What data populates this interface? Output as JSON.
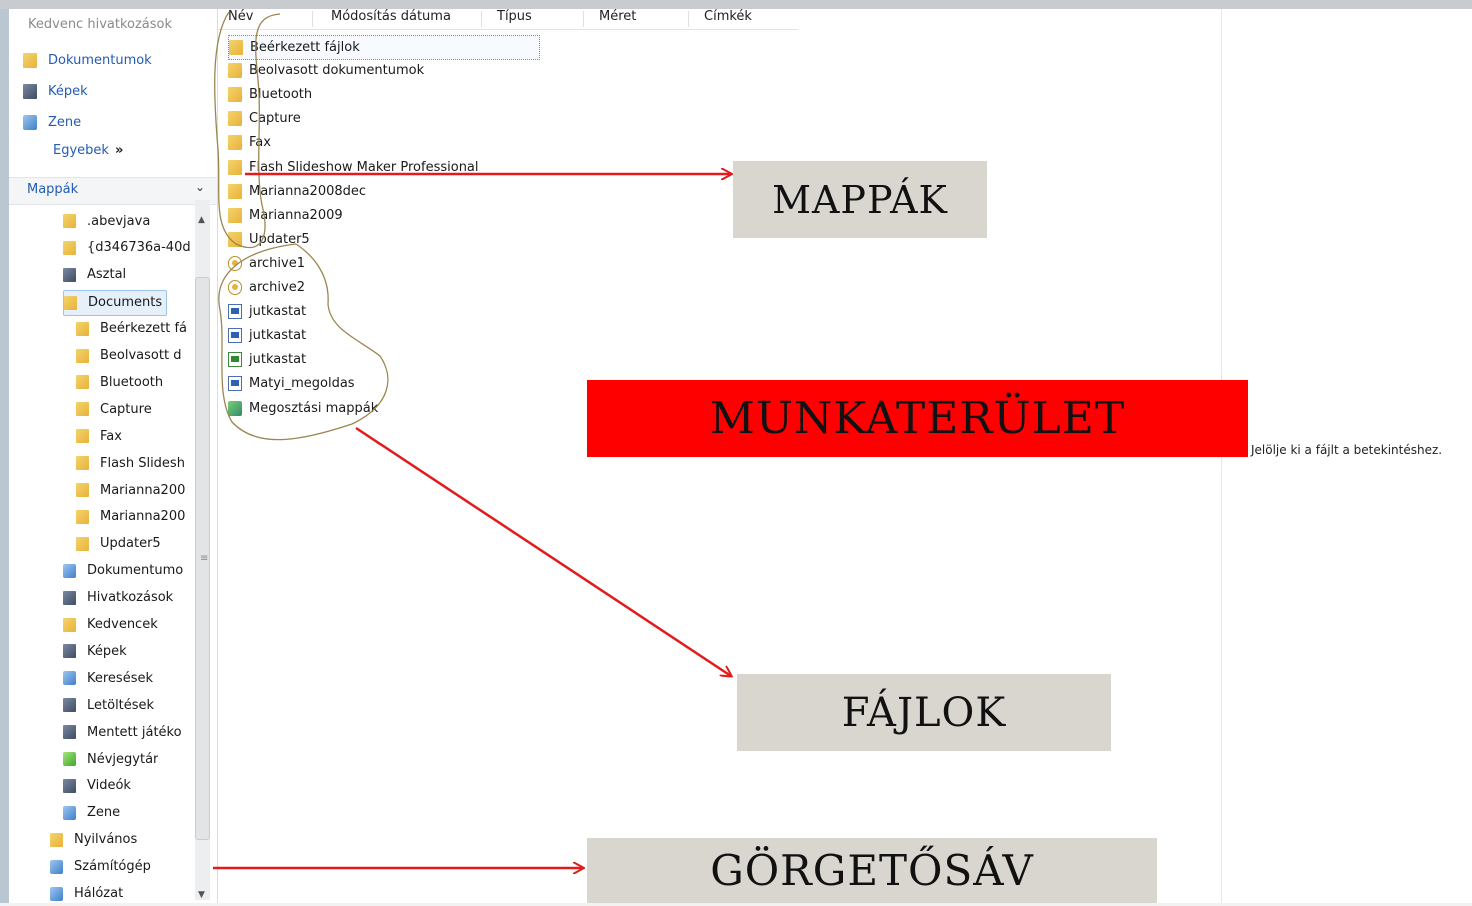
{
  "favorites": {
    "header": "Kedvenc hivatkozások",
    "items": [
      {
        "label": "Dokumentumok",
        "icon": "folder-icon"
      },
      {
        "label": "Képek",
        "icon": "pictures-icon"
      },
      {
        "label": "Zene",
        "icon": "music-icon"
      }
    ],
    "more_label": "Egyebek",
    "more_glyph": "»"
  },
  "folders_pane": {
    "title": "Mappák",
    "collapse_glyph": "⌄",
    "tree": [
      {
        "label": ".abevjava",
        "icon": "folder-icon"
      },
      {
        "label": "{d346736a-40d",
        "icon": "folder-icon"
      },
      {
        "label": "Asztal",
        "icon": "desktop-icon"
      },
      {
        "label": "Documents",
        "icon": "folder-icon",
        "selected": true
      },
      {
        "label": "Beérkezett fá",
        "icon": "folder-icon"
      },
      {
        "label": "Beolvasott d",
        "icon": "folder-icon"
      },
      {
        "label": "Bluetooth",
        "icon": "folder-icon"
      },
      {
        "label": "Capture",
        "icon": "folder-icon"
      },
      {
        "label": "Fax",
        "icon": "folder-icon"
      },
      {
        "label": "Flash Slidesh",
        "icon": "folder-icon"
      },
      {
        "label": "Marianna200",
        "icon": "folder-icon"
      },
      {
        "label": "Marianna200",
        "icon": "folder-icon"
      },
      {
        "label": "Updater5",
        "icon": "folder-icon"
      },
      {
        "label": "Dokumentumo",
        "icon": "documents-icon"
      },
      {
        "label": "Hivatkozások",
        "icon": "links-icon"
      },
      {
        "label": "Kedvencek",
        "icon": "favorites-icon"
      },
      {
        "label": "Képek",
        "icon": "pictures-icon"
      },
      {
        "label": "Keresések",
        "icon": "searches-icon"
      },
      {
        "label": "Letöltések",
        "icon": "downloads-icon"
      },
      {
        "label": "Mentett játéko",
        "icon": "saved-games-icon"
      },
      {
        "label": "Névjegytár",
        "icon": "contacts-icon"
      },
      {
        "label": "Videók",
        "icon": "videos-icon"
      },
      {
        "label": "Zene",
        "icon": "music-icon"
      },
      {
        "label": "Nyilvános",
        "icon": "folder-icon"
      },
      {
        "label": "Számítógép",
        "icon": "computer-icon"
      },
      {
        "label": "Hálózat",
        "icon": "network-icon"
      }
    ]
  },
  "columns": [
    "Név",
    "Módosítás dátuma",
    "Típus",
    "Méret",
    "Címkék"
  ],
  "files": [
    {
      "name": "Beérkezett fájlok",
      "icon": "folder-icon",
      "focused": true
    },
    {
      "name": "Beolvasott dokumentumok",
      "icon": "folder-icon"
    },
    {
      "name": "Bluetooth",
      "icon": "folder-icon"
    },
    {
      "name": "Capture",
      "icon": "folder-icon"
    },
    {
      "name": "Fax",
      "icon": "folder-icon"
    },
    {
      "name": "Flash Slideshow Maker Professional",
      "icon": "folder-icon"
    },
    {
      "name": "Marianna2008dec",
      "icon": "folder-icon"
    },
    {
      "name": "Marianna2009",
      "icon": "folder-icon"
    },
    {
      "name": "Updater5",
      "icon": "folder-icon"
    },
    {
      "name": "archive1",
      "icon": "archive-icon"
    },
    {
      "name": "archive2",
      "icon": "archive-icon"
    },
    {
      "name": "jutkastat",
      "icon": "word-document-icon"
    },
    {
      "name": "jutkastat",
      "icon": "word-document-icon"
    },
    {
      "name": "jutkastat",
      "icon": "excel-document-icon"
    },
    {
      "name": "Matyi_megoldas",
      "icon": "word-document-icon"
    },
    {
      "name": "Megosztási mappák",
      "icon": "shared-folder-icon"
    }
  ],
  "preview_text": "Jelölje ki a fájlt a betekintéshez.",
  "callouts": {
    "folders": "MAPPÁK",
    "workarea": "MUNKATERÜLET",
    "files": "FÁJLOK",
    "scrollbar": "GÖRGETŐSÁV"
  },
  "colors": {
    "arrow": "#e31b1b",
    "callout_gray": "#d9d5cf",
    "callout_red": "#ff0000",
    "link_blue": "#245bb3",
    "lasso": "#9c8650"
  }
}
